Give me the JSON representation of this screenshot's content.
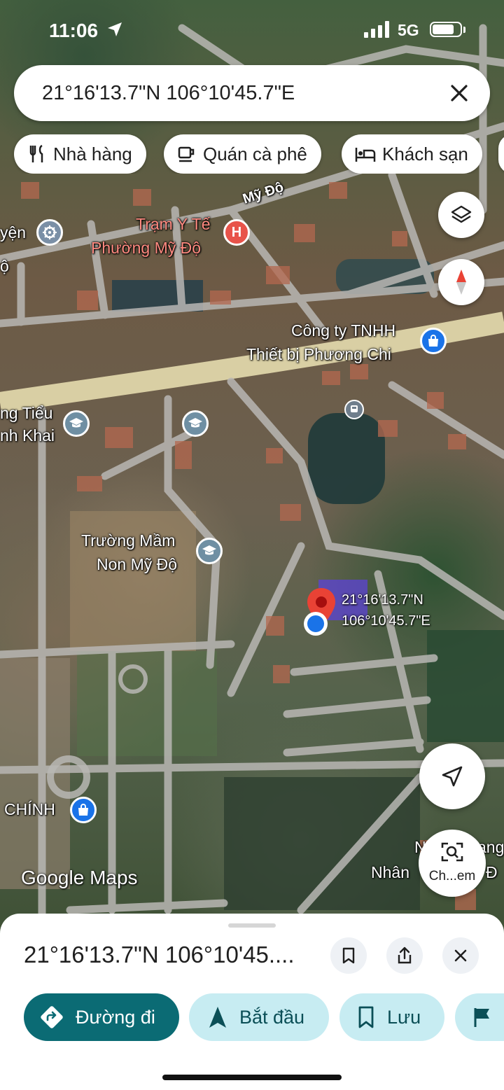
{
  "status_bar": {
    "time": "11:06",
    "network": "5G",
    "battery_level": 0.8
  },
  "search": {
    "query": "21°16'13.7\"N 106°10'45.7\"E"
  },
  "chips": [
    {
      "label": "Nhà hàng",
      "icon": "fork-knife-icon"
    },
    {
      "label": "Quán cà phê",
      "icon": "coffee-cup-icon"
    },
    {
      "label": "Khách sạn",
      "icon": "bed-icon"
    }
  ],
  "map": {
    "labels": {
      "road_my_do": "Mỹ Độ",
      "tram_y_te_1": "Trạm Y Tế",
      "tram_y_te_2": "Phường Mỹ Độ",
      "left_edge_1": "yện",
      "left_edge_2": "ộ",
      "cong_ty_1": "Công ty TNHH",
      "cong_ty_2": "Thiết bị Phương Chi",
      "tieu_1": "ng Tiểu",
      "tieu_2": "nh Khai",
      "mam_non_1": "Trường Mầm",
      "mam_non_2": "Non Mỹ Độ",
      "chinh": "CHÍNH",
      "bottom_right_1": "N",
      "bottom_right_2": "Nhân",
      "bottom_right_3": "ang",
      "bottom_right_4": "Đ"
    },
    "pin_label_1": "21°16'13.7\"N",
    "pin_label_2": "106°10'45.7\"E",
    "lens_label": "Ch...em",
    "google_logo": "Google Maps"
  },
  "bottom_sheet": {
    "title": "21°16'13.7\"N 106°10'45....",
    "actions": [
      {
        "label": "Đường đi",
        "icon": "directions-icon",
        "style": "primary"
      },
      {
        "label": "Bắt đầu",
        "icon": "navigation-arrow-icon",
        "style": "secondary"
      },
      {
        "label": "Lưu",
        "icon": "bookmark-icon",
        "style": "secondary"
      },
      {
        "label": "",
        "icon": "flag-icon",
        "style": "secondary"
      }
    ]
  },
  "colors": {
    "primary": "#0b6b74",
    "secondary": "#c7ecf2",
    "pin": "#e94235",
    "user_dot": "#1a73e8"
  }
}
